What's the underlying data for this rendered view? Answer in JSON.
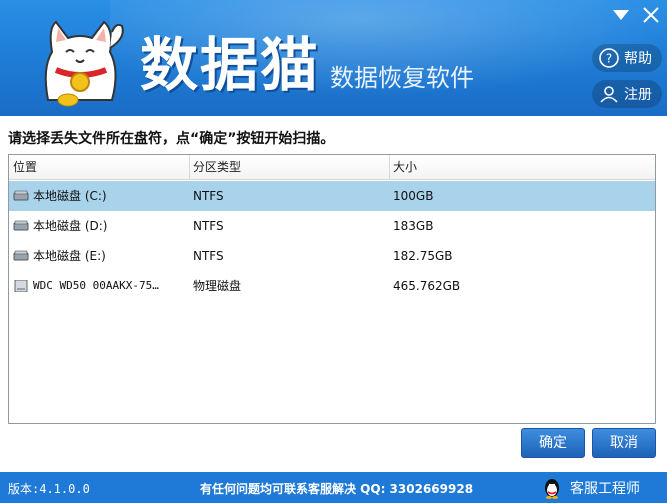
{
  "header": {
    "logo_text": "数据猫",
    "subtitle": "数据恢复软件",
    "help_label": "帮助",
    "register_label": "注册"
  },
  "instruction": "请选择丢失文件所在盘符，点“确定”按钮开始扫描。",
  "table": {
    "columns": [
      "位置",
      "分区类型",
      "大小"
    ],
    "rows": [
      {
        "location": "本地磁盘 (C:)",
        "type": "NTFS",
        "size": "100GB",
        "selected": true
      },
      {
        "location": "本地磁盘 (D:)",
        "type": "NTFS",
        "size": "183GB",
        "selected": false
      },
      {
        "location": "本地磁盘 (E:)",
        "type": "NTFS",
        "size": "182.75GB",
        "selected": false
      },
      {
        "location": "WDC WD50 00AAKX-75…",
        "type": "物理磁盘",
        "size": "465.762GB",
        "selected": false
      }
    ]
  },
  "buttons": {
    "ok": "确定",
    "cancel": "取消"
  },
  "footer": {
    "version": "版本:4.1.0.0",
    "contact": "有任何问题均可联系客服解决  QQ: 3302669928",
    "service": "客服工程师"
  },
  "colors": {
    "header_blue": "#1f7fd8",
    "selected_row": "#a9d3ea",
    "footer_blue": "#1e7ad6"
  }
}
